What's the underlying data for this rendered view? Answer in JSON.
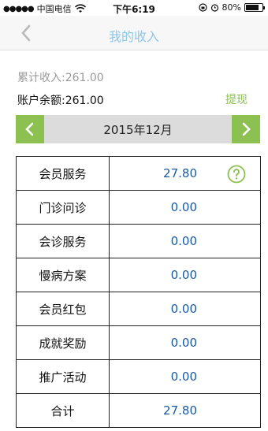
{
  "status_bar": {
    "signal": "●●●●●",
    "carrier": "中国电信",
    "time": "下午6:19",
    "battery": "80%",
    "battery_level": 0.8
  },
  "nav": {
    "title": "我的收入",
    "back_icon": "chevron-left-icon"
  },
  "summary": {
    "total_income": "累计收入:261.00",
    "balance_label": "账户余额:",
    "balance_value": "261.00",
    "withdraw": "提现"
  },
  "month_selector": {
    "label": "2015年12月",
    "prev_icon": "chevron-left-icon",
    "next_icon": "chevron-right-icon",
    "accent": "#8cc152"
  },
  "table": {
    "rows": [
      {
        "label": "会员服务",
        "amount": "27.80"
      },
      {
        "label": "门诊问诊",
        "amount": "0.00"
      },
      {
        "label": "会诊服务",
        "amount": "0.00"
      },
      {
        "label": "慢病方案",
        "amount": "0.00"
      },
      {
        "label": "会员红包",
        "amount": "0.00"
      },
      {
        "label": "成就奖励",
        "amount": "0.00"
      },
      {
        "label": "推广活动",
        "amount": "0.00"
      },
      {
        "label": "合计",
        "amount": "27.80"
      }
    ],
    "help_icon": "question-circle-icon"
  }
}
